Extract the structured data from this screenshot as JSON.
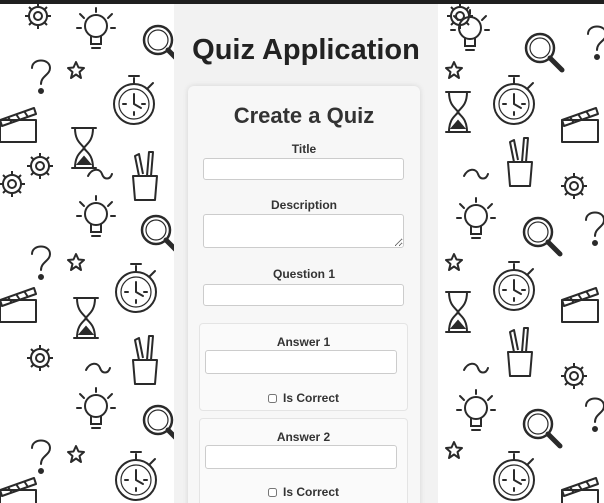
{
  "app": {
    "title": "Quiz Application"
  },
  "form": {
    "heading": "Create a Quiz",
    "title_label": "Title",
    "title_value": "",
    "description_label": "Description",
    "description_value": "",
    "question_label": "Question 1",
    "question_value": "",
    "answers": [
      {
        "label": "Answer 1",
        "value": "",
        "is_correct_label": "Is Correct",
        "is_correct": false
      },
      {
        "label": "Answer 2",
        "value": "",
        "is_correct_label": "Is Correct",
        "is_correct": false
      }
    ]
  },
  "colors": {
    "panel": "#f2f2f2",
    "text": "#333333",
    "doodle_stroke": "#2a2a2a"
  },
  "background": {
    "doodle_icons": [
      "question-mark-icon",
      "lightbulb-icon",
      "magnifier-icon",
      "stopwatch-icon",
      "hourglass-icon",
      "gear-icon",
      "clapperboard-icon",
      "pencil-cup-icon",
      "star-icon"
    ]
  }
}
